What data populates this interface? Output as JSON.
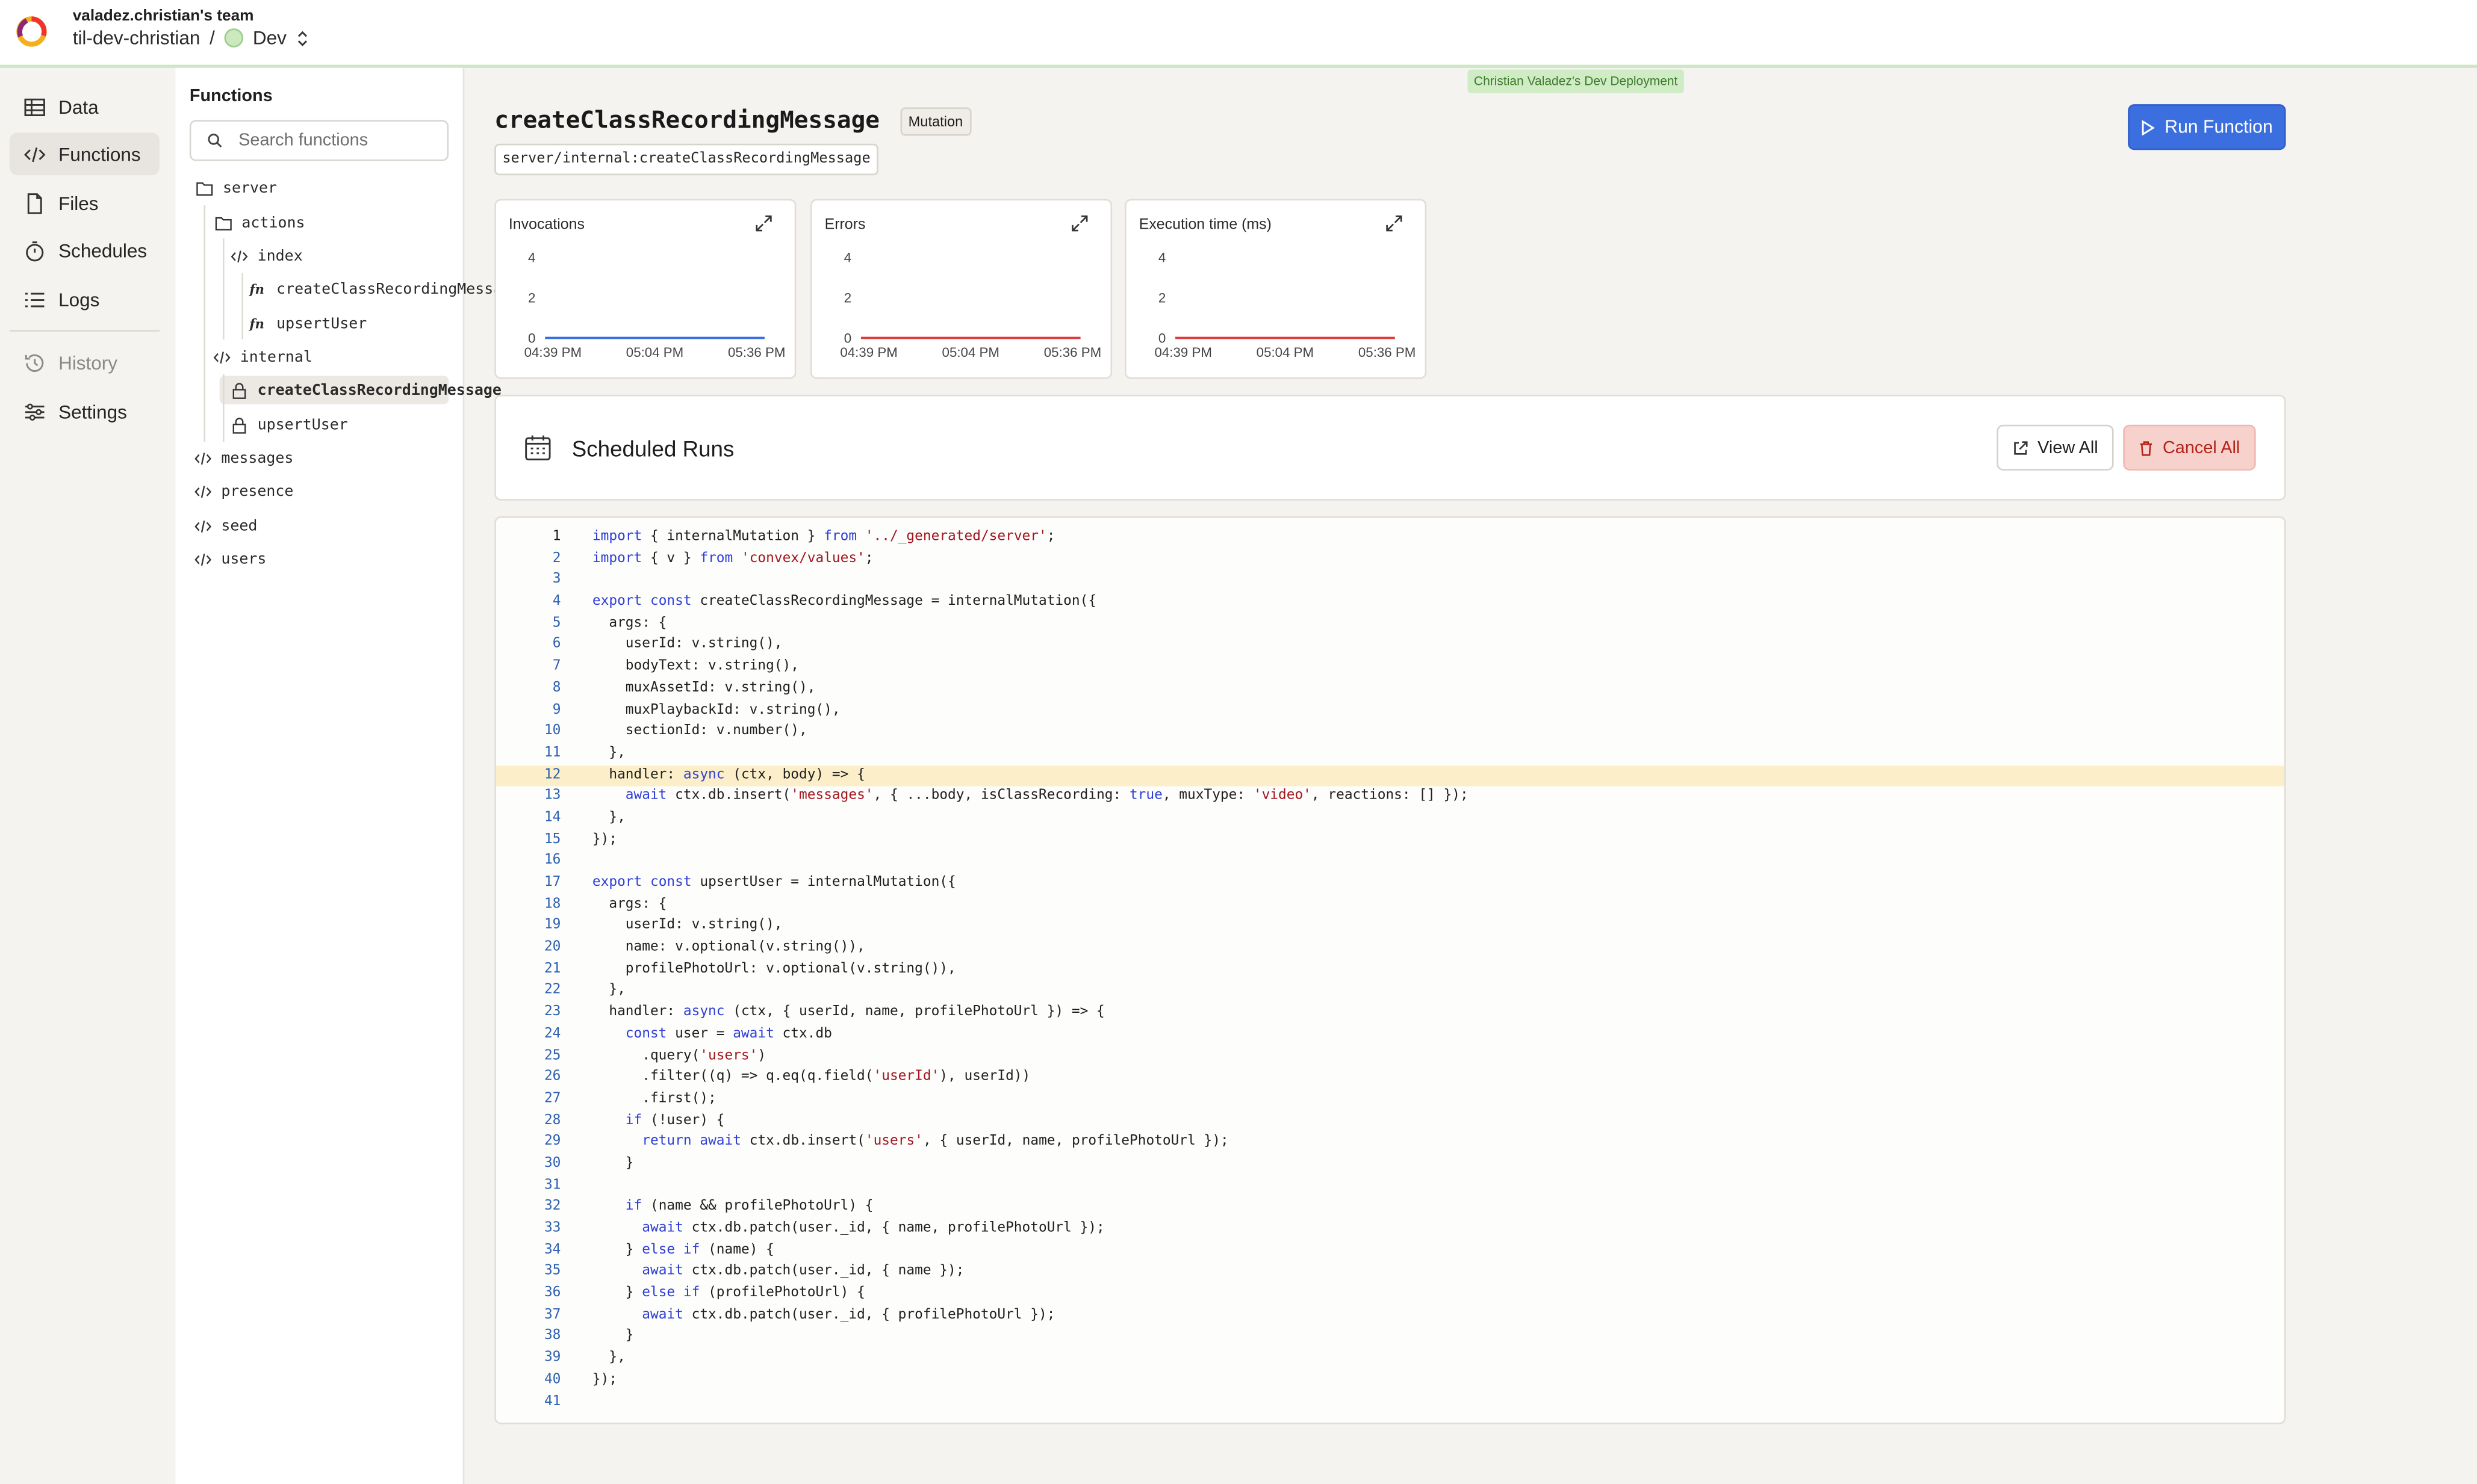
{
  "header": {
    "team": "valadez.christian's team",
    "project": "til-dev-christian",
    "separator": "/",
    "env": "Dev",
    "deployment_badge": "Christian Valadez's Dev Deployment"
  },
  "sidebar": {
    "items": [
      {
        "label": "Data",
        "icon": "table-icon"
      },
      {
        "label": "Functions",
        "icon": "code-icon"
      },
      {
        "label": "Files",
        "icon": "file-icon"
      },
      {
        "label": "Schedules",
        "icon": "stopwatch-icon"
      },
      {
        "label": "Logs",
        "icon": "list-icon"
      },
      {
        "label": "History",
        "icon": "history-icon"
      },
      {
        "label": "Settings",
        "icon": "sliders-icon"
      }
    ]
  },
  "functions_panel": {
    "title": "Functions",
    "search_placeholder": "Search functions",
    "tree": [
      {
        "label": "server"
      },
      {
        "label": "actions"
      },
      {
        "label": "index"
      },
      {
        "label": "createClassRecordingMessage"
      },
      {
        "label": "upsertUser"
      },
      {
        "label": "internal"
      },
      {
        "label": "createClassRecordingMessage"
      },
      {
        "label": "upsertUser"
      },
      {
        "label": "messages"
      },
      {
        "label": "presence"
      },
      {
        "label": "seed"
      },
      {
        "label": "users"
      }
    ]
  },
  "function": {
    "name": "createClassRecordingMessage",
    "type": "Mutation",
    "path": "server/internal:createClassRecordingMessage",
    "run_label": "Run Function"
  },
  "metrics": [
    {
      "title": "Invocations",
      "color": "#3b6fe0"
    },
    {
      "title": "Errors",
      "color": "#e03b3b"
    },
    {
      "title": "Execution time (ms)",
      "color": "#e03b3b"
    }
  ],
  "chart_data": [
    {
      "type": "line",
      "title": "Invocations",
      "categories": [
        "04:39 PM",
        "05:04 PM",
        "05:36 PM"
      ],
      "yticks": [
        0,
        2,
        4
      ],
      "ylim": [
        0,
        4
      ],
      "series": [
        {
          "values": [
            0,
            0,
            0
          ]
        }
      ]
    },
    {
      "type": "line",
      "title": "Errors",
      "categories": [
        "04:39 PM",
        "05:04 PM",
        "05:36 PM"
      ],
      "yticks": [
        0,
        2,
        4
      ],
      "ylim": [
        0,
        4
      ],
      "series": [
        {
          "values": [
            0,
            0,
            0
          ]
        }
      ]
    },
    {
      "type": "line",
      "title": "Execution time (ms)",
      "categories": [
        "04:39 PM",
        "05:04 PM",
        "05:36 PM"
      ],
      "yticks": [
        0,
        2,
        4
      ],
      "ylim": [
        0,
        4
      ],
      "series": [
        {
          "values": [
            0,
            0,
            0
          ]
        }
      ]
    }
  ],
  "scheduled": {
    "title": "Scheduled Runs",
    "view_all": "View All",
    "cancel_all": "Cancel All"
  },
  "code": {
    "highlight_line": 12,
    "current_line": 1,
    "lines": [
      "import { internalMutation } from '../_generated/server';",
      "import { v } from 'convex/values';",
      "",
      "export const createClassRecordingMessage = internalMutation({",
      "  args: {",
      "    userId: v.string(),",
      "    bodyText: v.string(),",
      "    muxAssetId: v.string(),",
      "    muxPlaybackId: v.string(),",
      "    sectionId: v.number(),",
      "  },",
      "  handler: async (ctx, body) => {",
      "    await ctx.db.insert('messages', { ...body, isClassRecording: true, muxType: 'video', reactions: [] });",
      "  },",
      "});",
      "",
      "export const upsertUser = internalMutation({",
      "  args: {",
      "    userId: v.string(),",
      "    name: v.optional(v.string()),",
      "    profilePhotoUrl: v.optional(v.string()),",
      "  },",
      "  handler: async (ctx, { userId, name, profilePhotoUrl }) => {",
      "    const user = await ctx.db",
      "      .query('users')",
      "      .filter((q) => q.eq(q.field('userId'), userId))",
      "      .first();",
      "    if (!user) {",
      "      return await ctx.db.insert('users', { userId, name, profilePhotoUrl });",
      "    }",
      "",
      "    if (name && profilePhotoUrl) {",
      "      await ctx.db.patch(user._id, { name, profilePhotoUrl });",
      "    } else if (name) {",
      "      await ctx.db.patch(user._id, { name });",
      "    } else if (profilePhotoUrl) {",
      "      await ctx.db.patch(user._id, { profilePhotoUrl });",
      "    }",
      "  },",
      "});",
      ""
    ]
  }
}
